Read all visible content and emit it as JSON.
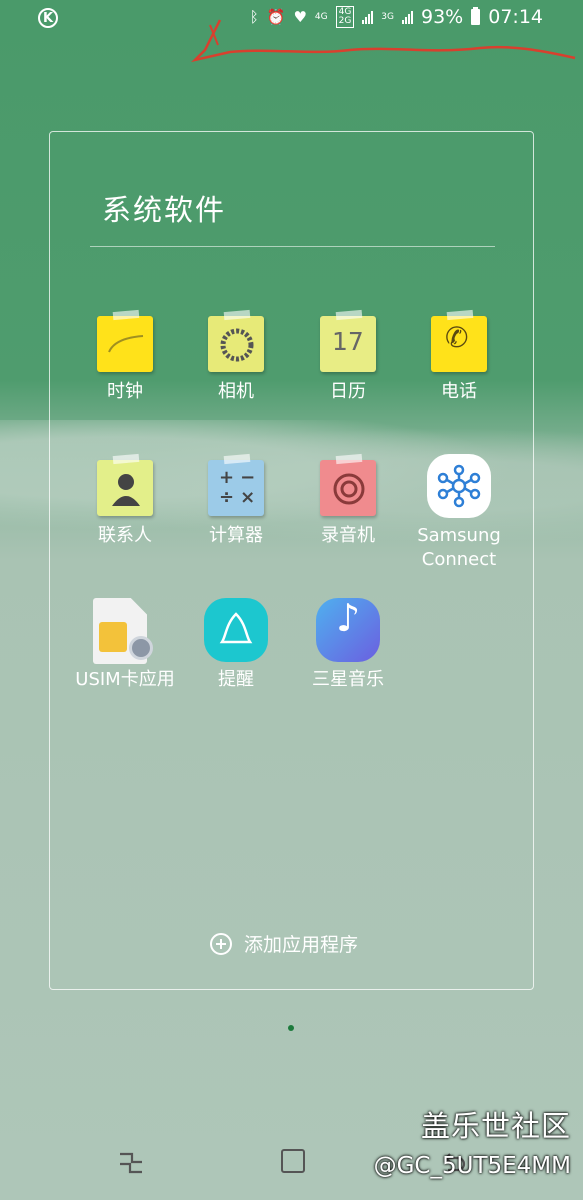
{
  "status_bar": {
    "network_1": "4G",
    "network_2_top": "4G",
    "network_2_bottom": "2G",
    "network_3": "3G",
    "battery": "93%",
    "time": "07:14",
    "icons": [
      "k-app-icon",
      "bluetooth-icon",
      "alarm-icon",
      "health-icon",
      "signal-icon",
      "battery-icon"
    ]
  },
  "folder": {
    "title": "系统软件",
    "add_apps_label": "添加应用程序",
    "apps": [
      {
        "label": "时钟",
        "icon": "clock-icon",
        "color": "#ffe21a"
      },
      {
        "label": "相机",
        "icon": "camera-icon",
        "color": "#e7ea78"
      },
      {
        "label": "日历",
        "icon": "calendar-icon",
        "color": "#e8ed85",
        "badge": "17"
      },
      {
        "label": "电话",
        "icon": "phone-icon",
        "color": "#ffe21a"
      },
      {
        "label": "联系人",
        "icon": "contacts-icon",
        "color": "#e3ef8a"
      },
      {
        "label": "计算器",
        "icon": "calculator-icon",
        "color": "#9ccbe8"
      },
      {
        "label": "录音机",
        "icon": "recorder-icon",
        "color": "#f08b8e"
      },
      {
        "label": "Samsung Connect",
        "icon": "samsung-connect-icon",
        "color": "#ffffff"
      },
      {
        "label": "USIM卡应用",
        "icon": "sim-card-icon",
        "color": "#f2f2f2"
      },
      {
        "label": "提醒",
        "icon": "reminder-icon",
        "color": "#1cc7cf"
      },
      {
        "label": "三星音乐",
        "icon": "music-icon",
        "color": "#5b7fe8"
      }
    ]
  },
  "navigation": {
    "recent_icon": "recent-apps-icon",
    "home_icon": "home-icon",
    "back_icon": "back-icon"
  },
  "watermark": {
    "title": "盖乐世社区",
    "user": "@GC_5UT5E4MM"
  }
}
